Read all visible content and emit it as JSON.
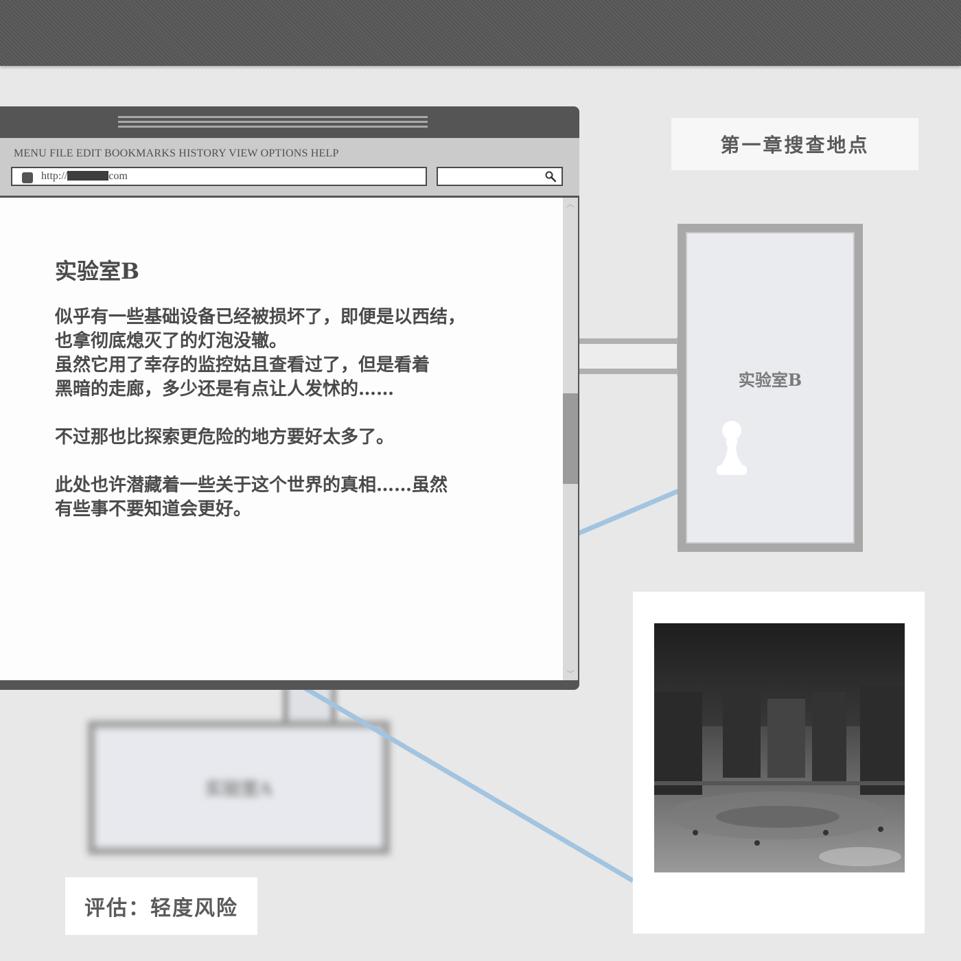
{
  "browser": {
    "menu": "MENU FILE EDIT BOOKMARKS HISTORY VIEW OPTIONS HELP",
    "url_prefix": "http://",
    "url_suffix": "com",
    "search_placeholder": ""
  },
  "article": {
    "title": "实验室B",
    "paragraphs": [
      "似乎有一些基础设备已经被损坏了，即便是以西结，\n也拿彻底熄灭了的灯泡没辙。\n虽然它用了幸存的监控姑且查看过了，但是看着\n黑暗的走廊，多少还是有点让人发怵的……",
      "不过那也比探索更危险的地方要好太多了。",
      "此处也许潜藏着一些关于这个世界的真相……虽然\n有些事不要知道会更好。"
    ]
  },
  "map": {
    "chapter_title": "第一章搜查地点",
    "room_label": "实验室B",
    "blurred_room_label": "实验室A",
    "connector_color": "#a2c4e0"
  },
  "assessment": "评估：轻度风险",
  "colors": {
    "window_frame": "#555555",
    "toolbar": "#cbcbcb",
    "text": "#4a4a4a"
  }
}
